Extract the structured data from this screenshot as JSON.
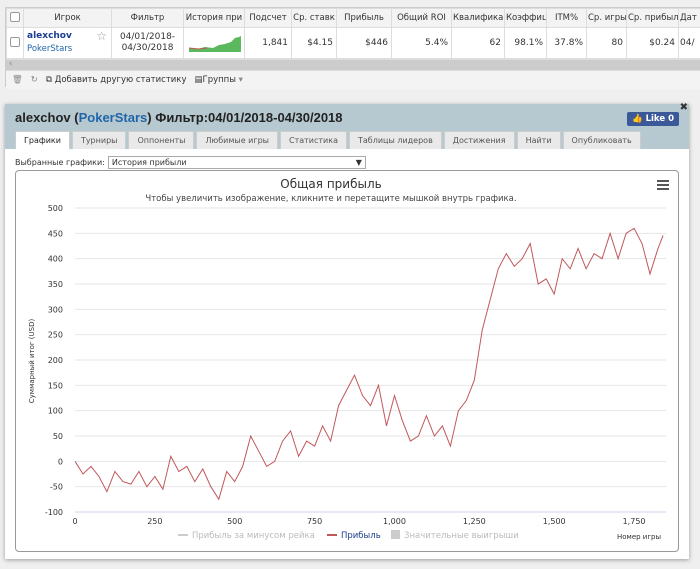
{
  "table": {
    "headers": [
      "Игрок",
      "Фильтр",
      "История при",
      "Подсчет",
      "Ср. ставк",
      "Прибыль",
      "Общий ROI",
      "Квалификац",
      "Коэффиц",
      "ITM%",
      "Ср. игры",
      "Ср. прибыл",
      "Дат"
    ],
    "row": {
      "player": "alexchov",
      "site": "PokerStars",
      "filter": "04/01/2018-04/30/2018",
      "count": "1,841",
      "avg_stake": "$4.15",
      "profit": "$446",
      "roi": "5.4%",
      "qual": "62",
      "coef": "98.1%",
      "itm": "37.8%",
      "avg_games": "80",
      "avg_profit": "$0.24",
      "date": "04/"
    }
  },
  "toolbar": {
    "add_stat": "Добавить другую статистику",
    "groups": "Группы"
  },
  "panel": {
    "player": "alexchov",
    "site": "PokerStars",
    "filter": "Фильтр:04/01/2018-04/30/2018",
    "like": "Like 0",
    "tabs": [
      "Графики",
      "Турниры",
      "Оппоненты",
      "Любимые игры",
      "Статистика",
      "Таблицы лидеров",
      "Достижения",
      "Найти",
      "Опубликовать"
    ],
    "select_label": "Выбранные графики:",
    "select_value": "История прибыли"
  },
  "colors": {
    "line": "#c0585a",
    "accent": "#2266aa"
  },
  "chart_data": {
    "type": "line",
    "title": "Общая прибыль",
    "subtitle": "Чтобы увеличить изображение, кликните и перетащите мышкой внутрь графика.",
    "xlabel": "Номер игры",
    "ylabel": "Суммарный итог (USD)",
    "xlim": [
      0,
      1841
    ],
    "ylim": [
      -100,
      500
    ],
    "xticks": [
      0,
      250,
      500,
      750,
      1000,
      1250,
      1500,
      1750
    ],
    "xtick_labels": [
      "0",
      "250",
      "500",
      "750",
      "1,000",
      "1,250",
      "1,500",
      "1,750"
    ],
    "yticks": [
      -100,
      -50,
      0,
      50,
      100,
      150,
      200,
      250,
      300,
      350,
      400,
      450,
      500
    ],
    "legend": [
      "Прибыль за минусом рейка",
      "Прибыль",
      "Значительные выигрыши"
    ],
    "series": [
      {
        "name": "Прибыль",
        "x": [
          0,
          25,
          50,
          75,
          100,
          125,
          150,
          175,
          200,
          225,
          250,
          275,
          300,
          325,
          350,
          375,
          400,
          425,
          450,
          475,
          500,
          525,
          550,
          575,
          600,
          625,
          650,
          675,
          700,
          725,
          750,
          775,
          800,
          825,
          850,
          875,
          900,
          925,
          950,
          975,
          1000,
          1025,
          1050,
          1075,
          1100,
          1125,
          1150,
          1175,
          1200,
          1225,
          1250,
          1275,
          1300,
          1325,
          1350,
          1375,
          1400,
          1425,
          1450,
          1475,
          1500,
          1525,
          1550,
          1575,
          1600,
          1625,
          1650,
          1675,
          1700,
          1725,
          1750,
          1775,
          1800,
          1825,
          1841
        ],
        "y": [
          0,
          -25,
          -10,
          -30,
          -60,
          -20,
          -40,
          -45,
          -20,
          -50,
          -30,
          -55,
          10,
          -20,
          -10,
          -40,
          -15,
          -50,
          -75,
          -20,
          -40,
          -10,
          50,
          20,
          -10,
          0,
          40,
          60,
          10,
          40,
          30,
          70,
          40,
          110,
          140,
          170,
          130,
          110,
          150,
          70,
          130,
          80,
          40,
          50,
          90,
          50,
          70,
          30,
          100,
          120,
          160,
          260,
          320,
          380,
          410,
          385,
          400,
          430,
          350,
          360,
          330,
          400,
          380,
          420,
          380,
          410,
          400,
          450,
          400,
          450,
          460,
          430,
          370,
          420,
          446
        ]
      }
    ]
  }
}
